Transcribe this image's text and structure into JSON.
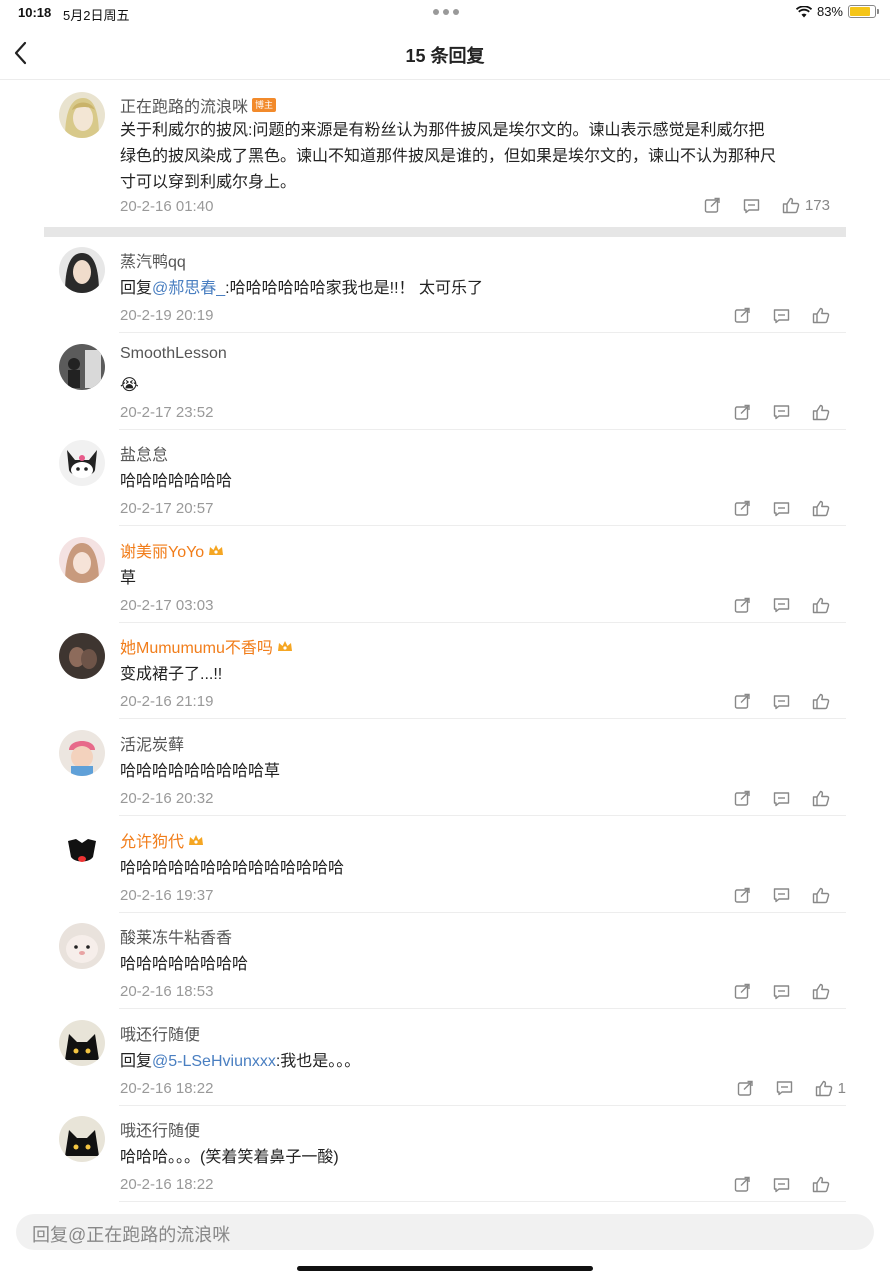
{
  "status_bar": {
    "time": "10:18",
    "date": "5月2日周五",
    "battery": "83%",
    "battery_level": 0.83
  },
  "header": {
    "title": "15 条回复",
    "back_icon": "chevron-left-icon"
  },
  "root_comment": {
    "name": "正在跑路的流浪咪",
    "badge": "博主",
    "text": "关于利威尔的披风:问题的来源是有粉丝认为那件披风是埃尔文的。谏山表示感觉是利威尔把绿色的披风染成了黑色。谏山不知道那件披风是谁的，但如果是埃尔文的，谏山不认为那种尺寸可以穿到利威尔身上。",
    "time": "20-2-16 01:40",
    "likes": "173"
  },
  "replies": [
    {
      "name": "蒸汽鸭qq",
      "prefix": "回复",
      "mention": "@郝思春_",
      "text": ":哈哈哈哈哈哈家我也是!!！ 太可乐了",
      "time": "20-2-19 20:19",
      "vip": false
    },
    {
      "name": "SmoothLesson",
      "text": "😭",
      "time": "20-2-17 23:52",
      "vip": false
    },
    {
      "name": "盐怠怠",
      "text": "哈哈哈哈哈哈哈",
      "time": "20-2-17 20:57",
      "vip": false
    },
    {
      "name": "谢美丽YoYo",
      "text": "草",
      "time": "20-2-17 03:03",
      "vip": true
    },
    {
      "name": "她Mumumumu不香吗",
      "text": "变成裙子了...!!",
      "time": "20-2-16 21:19",
      "vip": true
    },
    {
      "name": "活泥炭藓",
      "text": "哈哈哈哈哈哈哈哈哈草",
      "time": "20-2-16 20:32",
      "vip": false
    },
    {
      "name": "允许狗代",
      "text": "哈哈哈哈哈哈哈哈哈哈哈哈哈哈",
      "time": "20-2-16 19:37",
      "vip": true
    },
    {
      "name": "酸莱冻牛粘香香",
      "text": "哈哈哈哈哈哈哈哈",
      "time": "20-2-16 18:53",
      "vip": false
    },
    {
      "name": "哦还行随便",
      "prefix": "回复",
      "mention": "@5-LSeHviunxxx",
      "text": ":我也是。。。",
      "time": "20-2-16 18:22",
      "likes": "1",
      "vip": false
    },
    {
      "name": "哦还行随便",
      "text": "哈哈哈。。。(笑着笑着鼻子一酸)",
      "time": "20-2-16 18:22",
      "vip": false
    }
  ],
  "reply_input": {
    "placeholder": "回复@正在跑路的流浪咪"
  },
  "colors": {
    "vip_name": "#f17d1a",
    "mention": "#4a7fc1",
    "battery": "#f5c518"
  }
}
